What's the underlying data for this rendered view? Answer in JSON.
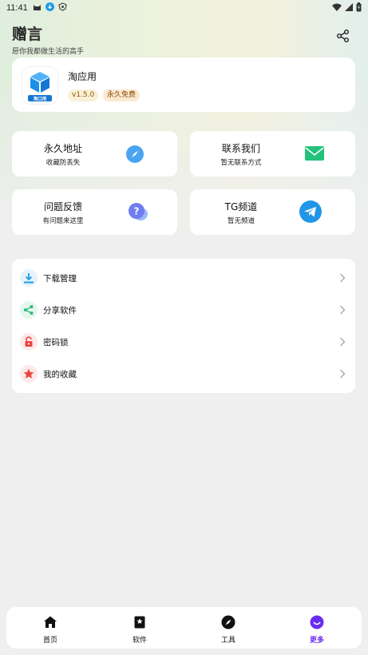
{
  "status_bar": {
    "time": "11:41"
  },
  "header": {
    "title": "赠言",
    "subtitle": "愿你我都做生活的高手"
  },
  "app_card": {
    "name": "淘应用",
    "logo_text": "淘口用",
    "version": "v1.5.0",
    "license": "永久免费"
  },
  "tiles": [
    {
      "title": "永久地址",
      "subtitle": "收藏防丢失",
      "icon": "compass-icon"
    },
    {
      "title": "联系我们",
      "subtitle": "暂无联系方式",
      "icon": "mail-icon"
    },
    {
      "title": "问题反馈",
      "subtitle": "有问题来这里",
      "icon": "question-chat-icon"
    },
    {
      "title": "TG频道",
      "subtitle": "暂无频道",
      "icon": "telegram-icon"
    }
  ],
  "menu": [
    {
      "label": "下载管理",
      "icon": "download-icon",
      "color": "#1e9be6"
    },
    {
      "label": "分享软件",
      "icon": "share-icon",
      "color": "#2db87a"
    },
    {
      "label": "密码锁",
      "icon": "lock-icon",
      "color": "#e8453c"
    },
    {
      "label": "我的收藏",
      "icon": "star-icon",
      "color": "#e8453c"
    }
  ],
  "nav": [
    {
      "label": "首页",
      "icon": "home-icon",
      "active": false
    },
    {
      "label": "软件",
      "icon": "bookmark-icon",
      "active": false
    },
    {
      "label": "工具",
      "icon": "compass-icon",
      "active": false
    },
    {
      "label": "更多",
      "icon": "smile-icon",
      "active": true
    }
  ],
  "colors": {
    "accent": "#6a2cf0",
    "blue": "#2196f3",
    "green": "#22c27a"
  }
}
